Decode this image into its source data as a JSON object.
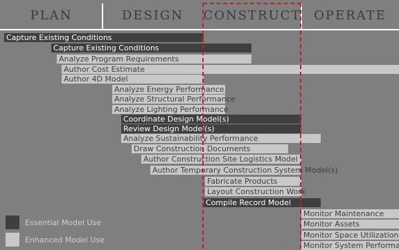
{
  "phases": [
    "PLAN",
    "DESIGN",
    "CONSTRUCT",
    "OPERATE"
  ],
  "colors": {
    "background": "#7f7f7f",
    "essential": "#3f3f3f",
    "enhanced": "#c8c8c8",
    "highlight_border": "#c0202a"
  },
  "highlighted_phase": "CONSTRUCT",
  "bars": [
    {
      "label": "Capture Existing Conditions",
      "type": "essential"
    },
    {
      "label": "Capture Existing Conditions",
      "type": "essential"
    },
    {
      "label": "Analyze Program Requirements",
      "type": "enhanced"
    },
    {
      "label": "Author Cost Estimate",
      "type": "enhanced"
    },
    {
      "label": "Author 4D Model",
      "type": "enhanced"
    },
    {
      "label": "Analyze Energy Performance",
      "type": "enhanced"
    },
    {
      "label": "Analyze Structural Performance",
      "type": "enhanced"
    },
    {
      "label": "Analyze Lighting Performance",
      "type": "enhanced"
    },
    {
      "label": "Coordinate Design Model(s)",
      "type": "essential"
    },
    {
      "label": "Review Design Model(s)",
      "type": "essential"
    },
    {
      "label": "Analyze Sustainability Performance",
      "type": "enhanced"
    },
    {
      "label": "Draw Construction Documents",
      "type": "enhanced"
    },
    {
      "label": "Author Construction Site Logistics Model",
      "type": "enhanced"
    },
    {
      "label": "Author Temporary Construction System Model(s)",
      "type": "enhanced"
    },
    {
      "label": "Fabricate Products",
      "type": "enhanced"
    },
    {
      "label": "Layout Construction Work",
      "type": "enhanced"
    },
    {
      "label": "Compile Record Model",
      "type": "essential"
    },
    {
      "label": "Monitor Maintenance",
      "type": "enhanced"
    },
    {
      "label": "Monitor Assets",
      "type": "enhanced"
    },
    {
      "label": "Monitor Space Utilization",
      "type": "enhanced"
    },
    {
      "label": "Monitor System Performance",
      "type": "enhanced"
    }
  ],
  "legend": [
    {
      "label": "Essential Model Use",
      "type": "essential"
    },
    {
      "label": "Enhanced Model Use",
      "type": "enhanced"
    }
  ]
}
